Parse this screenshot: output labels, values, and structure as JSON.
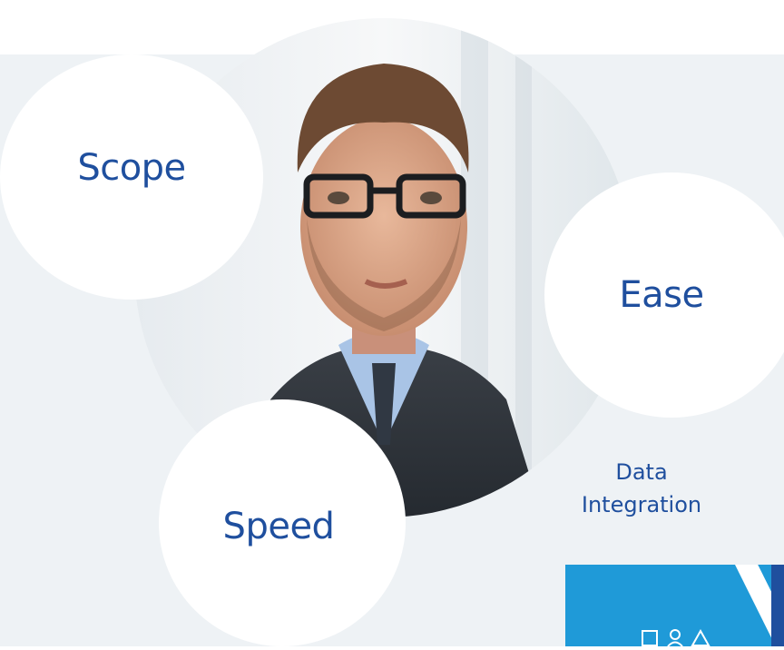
{
  "bubbles": {
    "scope": "Scope",
    "ease": "Ease",
    "speed": "Speed"
  },
  "caption": {
    "line1": "Data",
    "line2": "Integration"
  },
  "colors": {
    "text": "#1f4f9e",
    "background": "#eef2f5",
    "tile": "#1f9ad8"
  },
  "icons": [
    "square-icon",
    "person-icon",
    "triangle-icon"
  ]
}
